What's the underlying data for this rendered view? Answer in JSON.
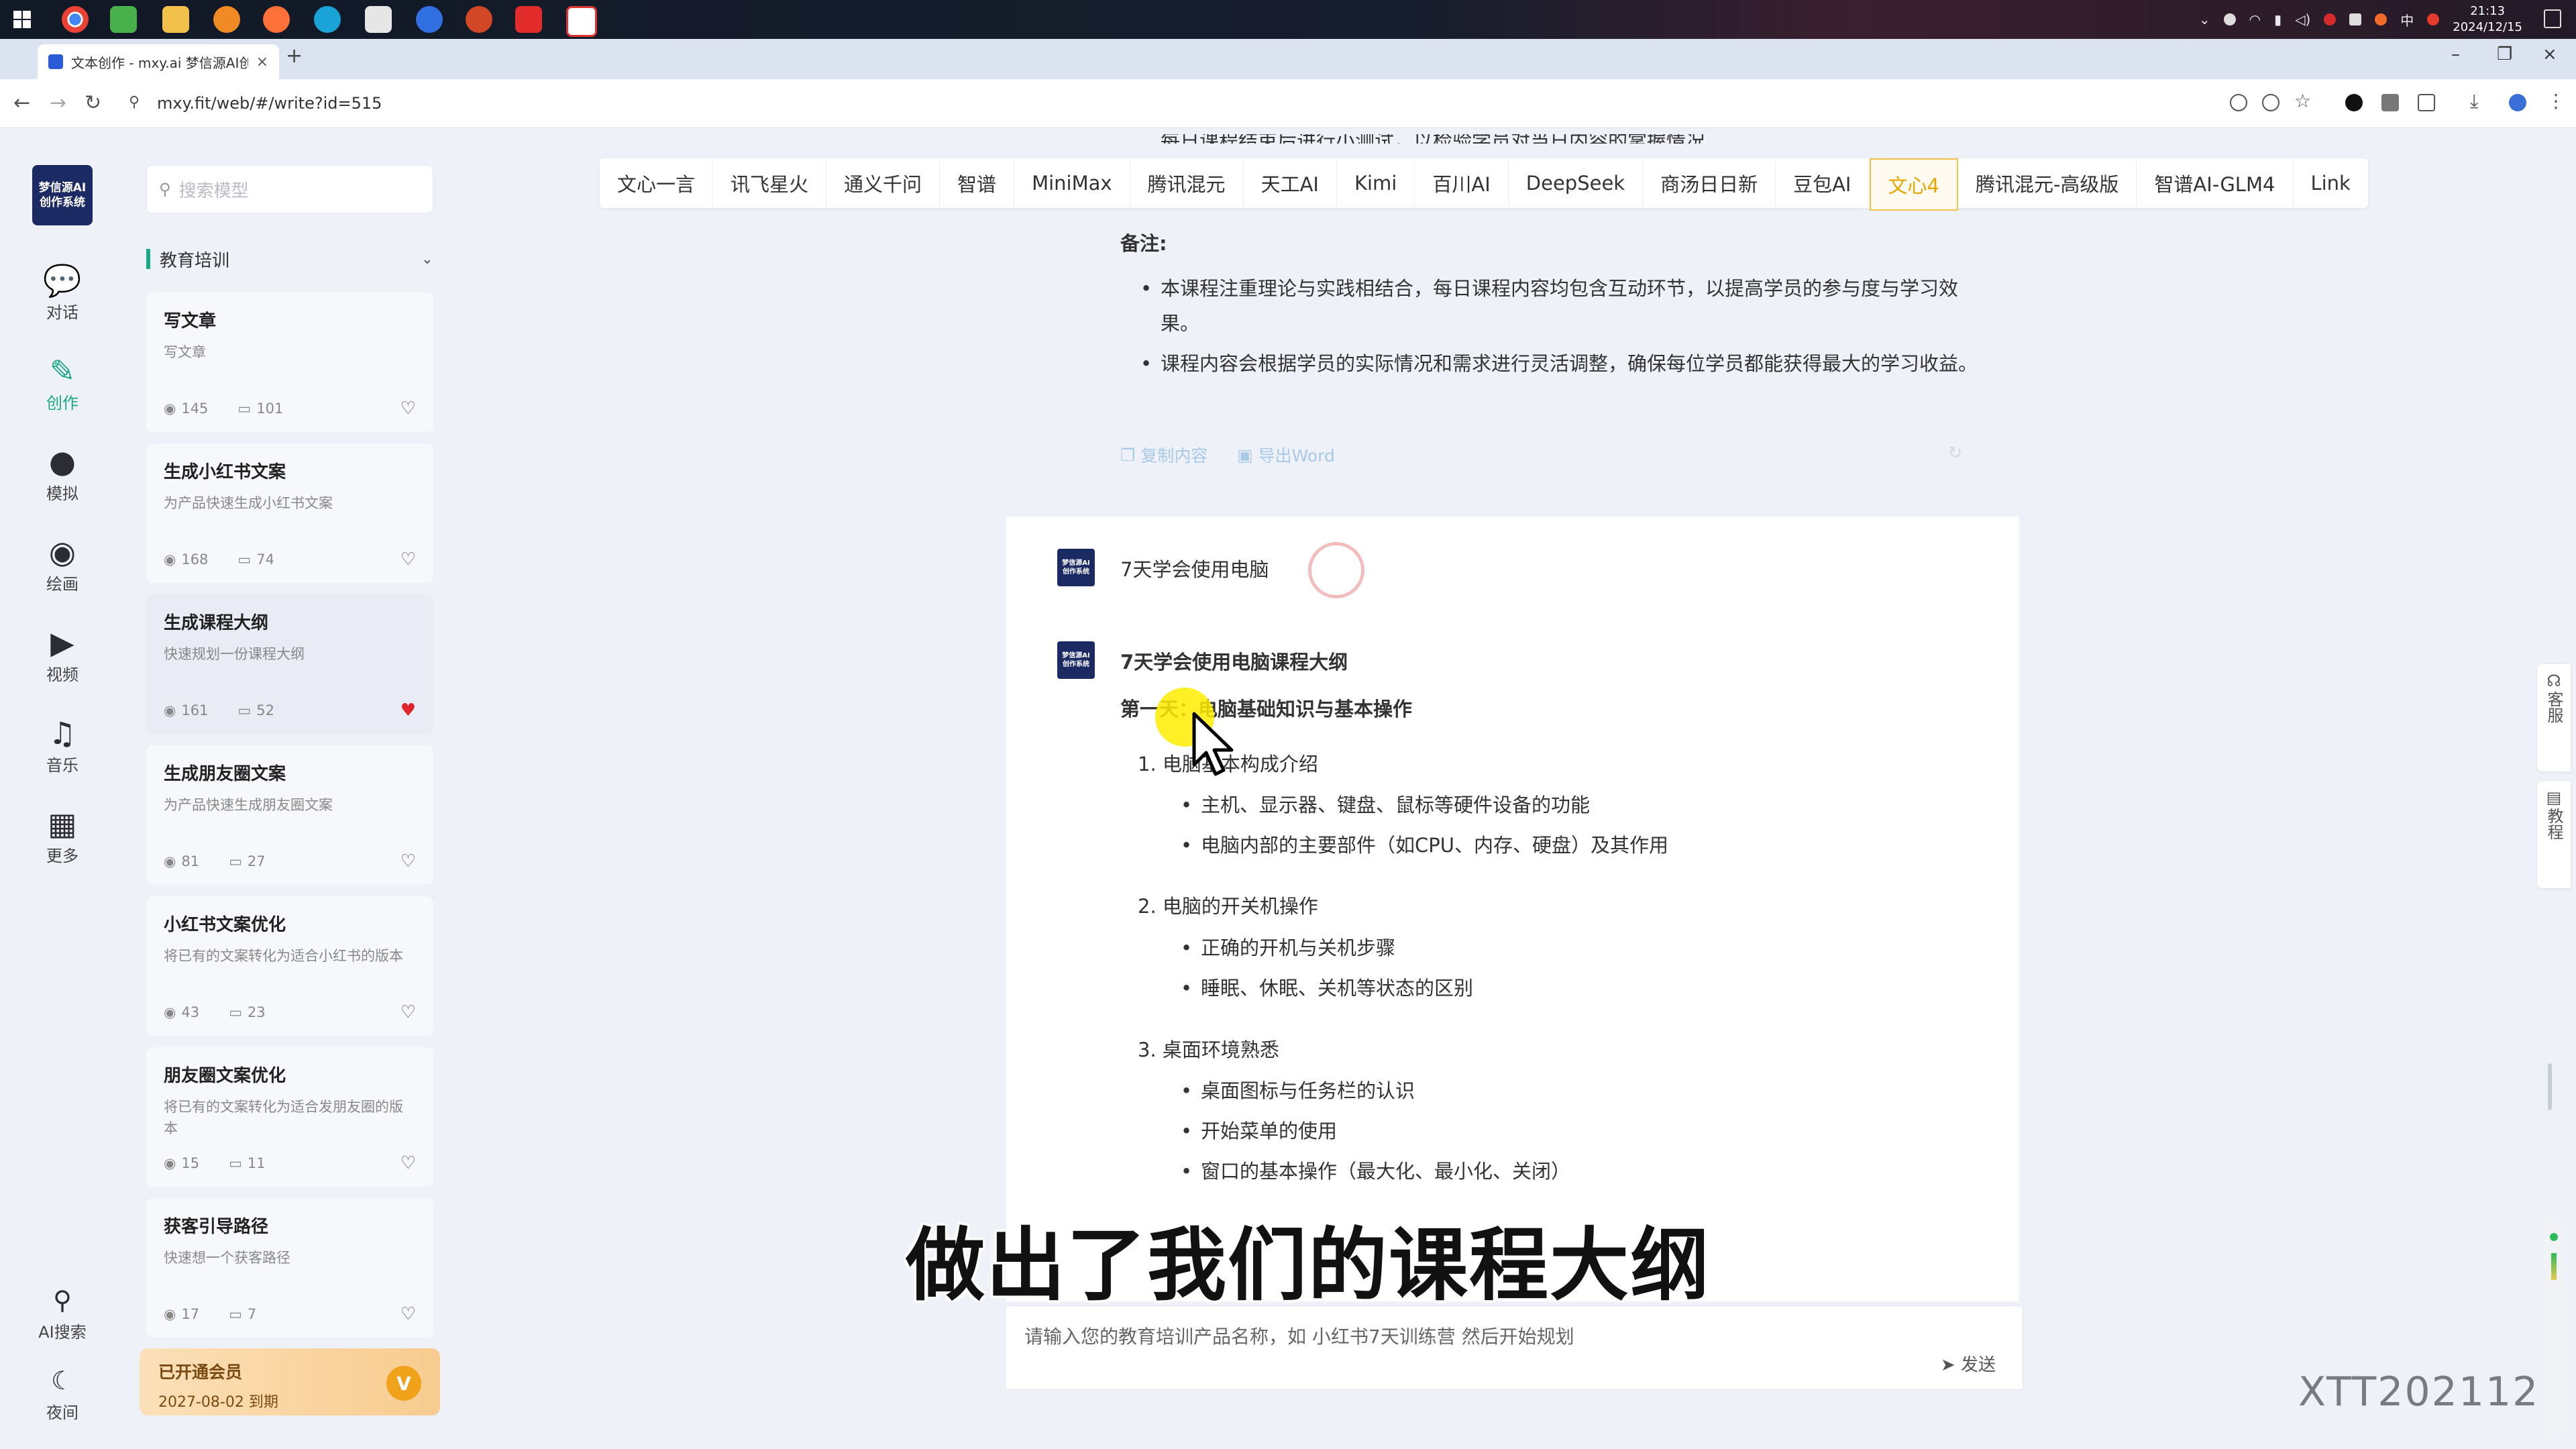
{
  "taskbar": {
    "time": "21:13",
    "date": "2024/12/15",
    "ime": "中"
  },
  "browser": {
    "tab_title": "文本创作 - mxy.ai 梦信源AI创",
    "url": "mxy.fit/web/#/write?id=515"
  },
  "logo": {
    "line1": "梦信源AI",
    "line2": "创作系统"
  },
  "sidebar": {
    "items": [
      {
        "label": "对话",
        "icon": "chat-bubble-icon"
      },
      {
        "label": "创作",
        "icon": "feather-icon"
      },
      {
        "label": "模拟",
        "icon": "head-icon"
      },
      {
        "label": "绘画",
        "icon": "palette-icon"
      },
      {
        "label": "视频",
        "icon": "video-icon"
      },
      {
        "label": "音乐",
        "icon": "music-note-icon"
      },
      {
        "label": "更多",
        "icon": "grid-icon"
      }
    ],
    "bottom": [
      {
        "label": "AI搜索",
        "icon": "search-icon"
      },
      {
        "label": "夜间",
        "icon": "moon-icon"
      }
    ]
  },
  "panel": {
    "search_placeholder": "搜索模型",
    "category": "教育培训",
    "cards": [
      {
        "title": "写文章",
        "desc": "写文章",
        "views": "145",
        "comments": "101",
        "liked": false
      },
      {
        "title": "生成小红书文案",
        "desc": "为产品快速生成小红书文案",
        "views": "168",
        "comments": "74",
        "liked": false
      },
      {
        "title": "生成课程大纲",
        "desc": "快速规划一份课程大纲",
        "views": "161",
        "comments": "52",
        "liked": true
      },
      {
        "title": "生成朋友圈文案",
        "desc": "为产品快速生成朋友圈文案",
        "views": "81",
        "comments": "27",
        "liked": false
      },
      {
        "title": "小红书文案优化",
        "desc": "将已有的文案转化为适合小红书的版本",
        "views": "43",
        "comments": "23",
        "liked": false
      },
      {
        "title": "朋友圈文案优化",
        "desc": "将已有的文案转化为适合发朋友圈的版本",
        "views": "15",
        "comments": "11",
        "liked": false
      },
      {
        "title": "获客引导路径",
        "desc": "快速想一个获客路径",
        "views": "17",
        "comments": "7",
        "liked": false
      }
    ],
    "vip": {
      "title": "已开通会员",
      "expiry": "2027-08-02 到期",
      "badge": "V"
    }
  },
  "models": [
    "文心一言",
    "讯飞星火",
    "通义千问",
    "智谱",
    "MiniMax",
    "腾讯混元",
    "天工AI",
    "Kimi",
    "百川AI",
    "DeepSeek",
    "商汤日日新",
    "豆包AI",
    "文心4",
    "腾讯混元-高级版",
    "智谱AI-GLM4",
    "Link"
  ],
  "selected_model": "文心4",
  "chat": {
    "prev": {
      "cutoff_line": "每日课程结束后进行小测试，以检验学员对当日内容的掌握情况",
      "note_heading": "备注:",
      "notes": [
        "本课程注重理论与实践相结合，每日课程内容均包含互动环节，以提高学员的参与度与学习效果。",
        "课程内容会根据学员的实际情况和需求进行灵活调整，确保每位学员都能获得最大的学习收益。"
      ],
      "copy_label": "复制内容",
      "export_label": "导出Word"
    },
    "user_message": "7天学会使用电脑",
    "answer": {
      "title": "7天学会使用电脑课程大纲",
      "day1": "第一天：电脑基础知识与基本操作",
      "sections": [
        {
          "heading": "1. 电脑基本构成介绍",
          "points": [
            "主机、显示器、键盘、鼠标等硬件设备的功能",
            "电脑内部的主要部件（如CPU、内存、硬盘）及其作用"
          ]
        },
        {
          "heading": "2. 电脑的开关机操作",
          "points": [
            "正确的开机与关机步骤",
            "睡眠、休眠、关机等状态的区别"
          ]
        },
        {
          "heading": "3. 桌面环境熟悉",
          "points": [
            "桌面图标与任务栏的认识",
            "开始菜单的使用",
            "窗口的基本操作（最大化、最小化、关闭）"
          ]
        }
      ]
    },
    "input_placeholder": "请输入您的教育培训产品名称，如 小红书7天训练营 然后开始规划",
    "send_label": "发送"
  },
  "side_widgets": {
    "service": "客服",
    "tutorial": "教程"
  },
  "subtitle_caption": "做出了我们的课程大纲",
  "watermark": "XTT202112"
}
